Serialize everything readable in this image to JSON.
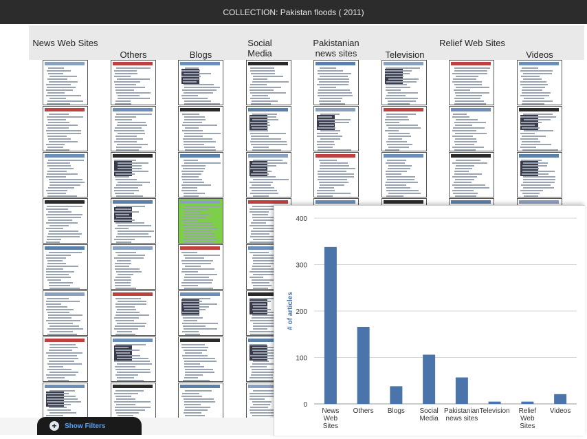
{
  "header": {
    "title": "COLLECTION: Pakistan floods ( 2011)"
  },
  "columns": [
    {
      "label": "News Web Sites"
    },
    {
      "label": "Others"
    },
    {
      "label": "Blogs"
    },
    {
      "label": "Social Media"
    },
    {
      "label": "Pakistanian news sites"
    },
    {
      "label": "Television"
    },
    {
      "label": "Relief Web Sites"
    },
    {
      "label": "Videos"
    }
  ],
  "footer": {
    "show_filters": "Show Filters"
  },
  "chart_data": {
    "type": "bar",
    "categories": [
      "News Web Sites",
      "Others",
      "Blogs",
      "Social Media",
      "Pakistanian news sites",
      "Television",
      "Relief Web Sites",
      "Videos"
    ],
    "values": [
      338,
      166,
      38,
      106,
      57,
      5,
      5,
      21
    ],
    "ylabel": "# of articles",
    "ylim": [
      0,
      400
    ],
    "yticks": [
      0,
      100,
      200,
      300,
      400
    ],
    "grid": true,
    "color": "#4a74aa"
  }
}
